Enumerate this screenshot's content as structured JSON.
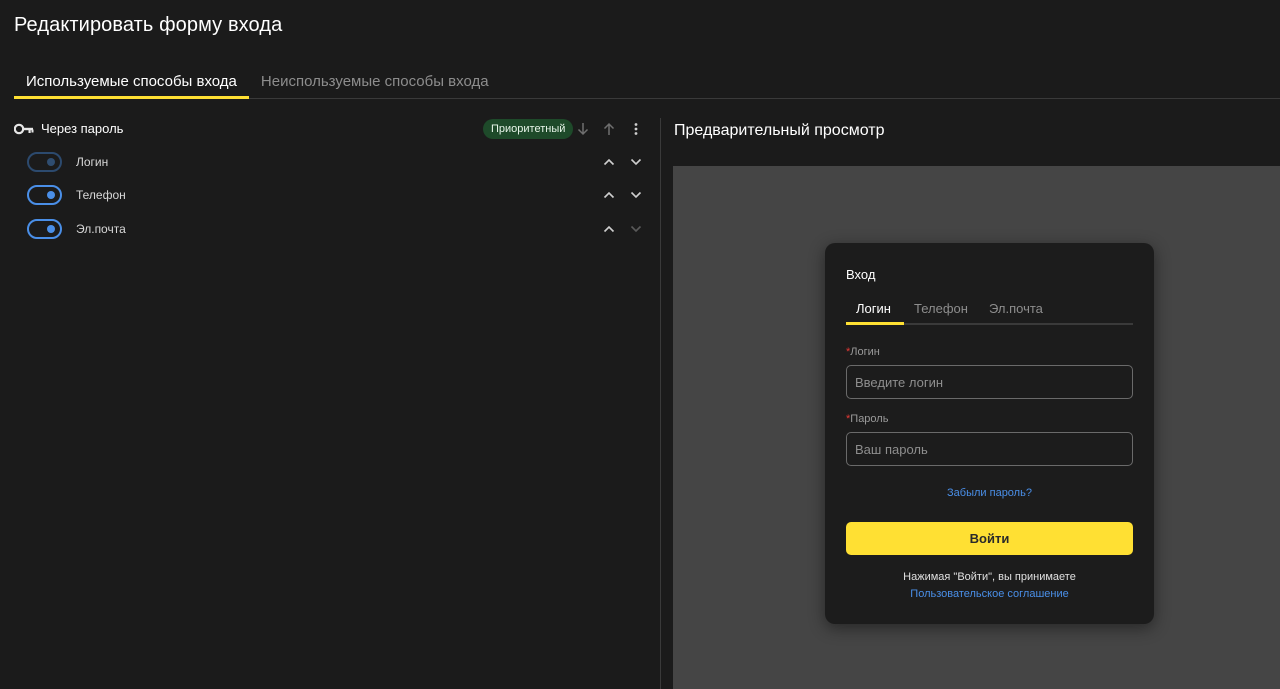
{
  "page": {
    "title": "Редактировать форму входа"
  },
  "tabs": [
    {
      "label": "Используемые способы входа",
      "active": true
    },
    {
      "label": "Неиспользуемые способы входа",
      "active": false
    }
  ],
  "methods_group": {
    "label": "Через пароль",
    "icon": "key-icon",
    "badge": "Приоритетный",
    "actions": [
      "arrow-down-icon",
      "arrow-up-icon",
      "more-vert-icon"
    ],
    "items": [
      {
        "label": "Логин",
        "enabled": true,
        "toggle_disabled": true
      },
      {
        "label": "Телефон",
        "enabled": true,
        "toggle_disabled": false
      },
      {
        "label": "Эл.почта",
        "enabled": true,
        "toggle_disabled": false
      }
    ]
  },
  "preview": {
    "title": "Предварительный просмотр",
    "card": {
      "title": "Вход",
      "tabs": [
        "Логин",
        "Телефон",
        "Эл.почта"
      ],
      "active_tab": "Логин",
      "login_field": {
        "required_mark": "*",
        "label": "Логин",
        "placeholder": "Введите логин"
      },
      "password_field": {
        "required_mark": "*",
        "label": "Пароль",
        "placeholder": "Ваш пароль"
      },
      "forgot_link": "Забыли пароль?",
      "submit_label": "Войти",
      "agree_text": "Нажимая \"Войти\", вы принимаете",
      "agree_link": "Пользовательское соглашение"
    }
  },
  "colors": {
    "background": "#1b1b1b",
    "accent": "#ffe033",
    "toggle": "#4a8fe8",
    "badge_bg": "#1e4a2a",
    "preview_bg": "#454545",
    "link": "#4a8fe8",
    "required": "#e53935"
  }
}
